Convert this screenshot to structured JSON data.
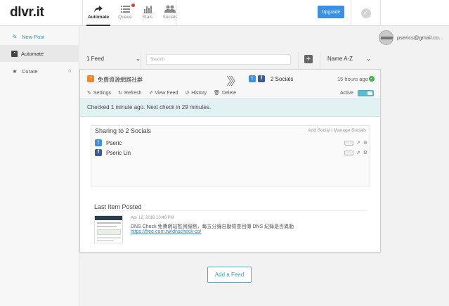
{
  "brand": {
    "logo": "dlvr.it"
  },
  "topnav": [
    {
      "label": "Automate",
      "icon": "share-arrow-icon",
      "active": true
    },
    {
      "label": "Queue",
      "icon": "list-icon",
      "badge": true
    },
    {
      "label": "Stats",
      "icon": "bar-chart-icon"
    },
    {
      "label": "Socials",
      "icon": "people-icon"
    }
  ],
  "header": {
    "upgrade_label": "Upgrade"
  },
  "user": {
    "email": "pserics@gmail.co..."
  },
  "sidebar": {
    "new_post": "New Post",
    "automate": "Automate",
    "curate": "Curate",
    "curate_count": "0"
  },
  "filters": {
    "feed_select": "1 Feed",
    "search_placeholder": "Search",
    "sort_select": "Name A-Z"
  },
  "feed": {
    "name": "免費資源網路社群",
    "social_count": "2 Socials",
    "time_ago": "15 hours ago",
    "actions": {
      "settings": "Settings",
      "refresh": "Refresh",
      "view_feed": "View Feed",
      "history": "History",
      "delete": "Delete"
    },
    "active_label": "Active",
    "info": "Checked 1 minute ago. Next check in 29 minutes.",
    "sharing_title": "Sharing to 2 Socials",
    "sharing_links": "Add Social | Manage Socials",
    "socials": [
      {
        "name": "Pseric",
        "network": "twitter"
      },
      {
        "name": "Pseric Lin",
        "network": "facebook"
      }
    ],
    "last_item_title": "Last Item Posted",
    "last_item": {
      "date": "Apr 12, 2016 10:49 PM",
      "text": "DNS Check 免費網站監測服務，每五分鐘自動檢查回傳 DNS 紀錄是否異動",
      "link": "https://free.com.tw/dnscheck-co/"
    }
  },
  "add_feed_label": "Add a Feed",
  "colors": {
    "accent": "#3d8fe6",
    "teal": "#4cb1c8",
    "rss": "#f0882a",
    "ok": "#3ab54a"
  }
}
